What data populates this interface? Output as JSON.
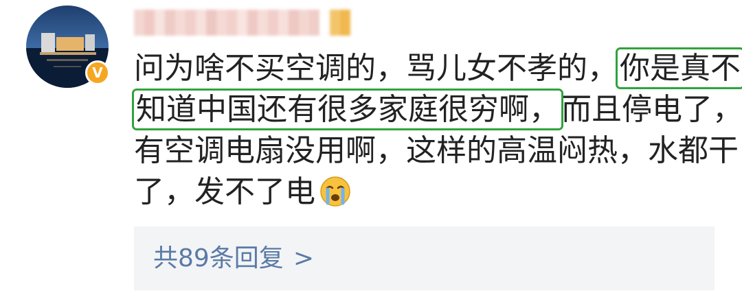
{
  "comment": {
    "username_blurred": true,
    "verified": true,
    "verified_badge_label": "V",
    "text_lines": [
      "问为啥不买空调的，骂儿女不孝的，",
      "你是真不",
      "知道中国还有很多家庭很穷啊，",
      "而且停电了，",
      "有空调电扇没用啊，这样的高温闷热，水都干",
      "了，发不了电"
    ],
    "emoji": "crying-face",
    "highlight_color": "#2fa33b",
    "replies_label": "共89条回复",
    "replies_chevron": ">"
  }
}
